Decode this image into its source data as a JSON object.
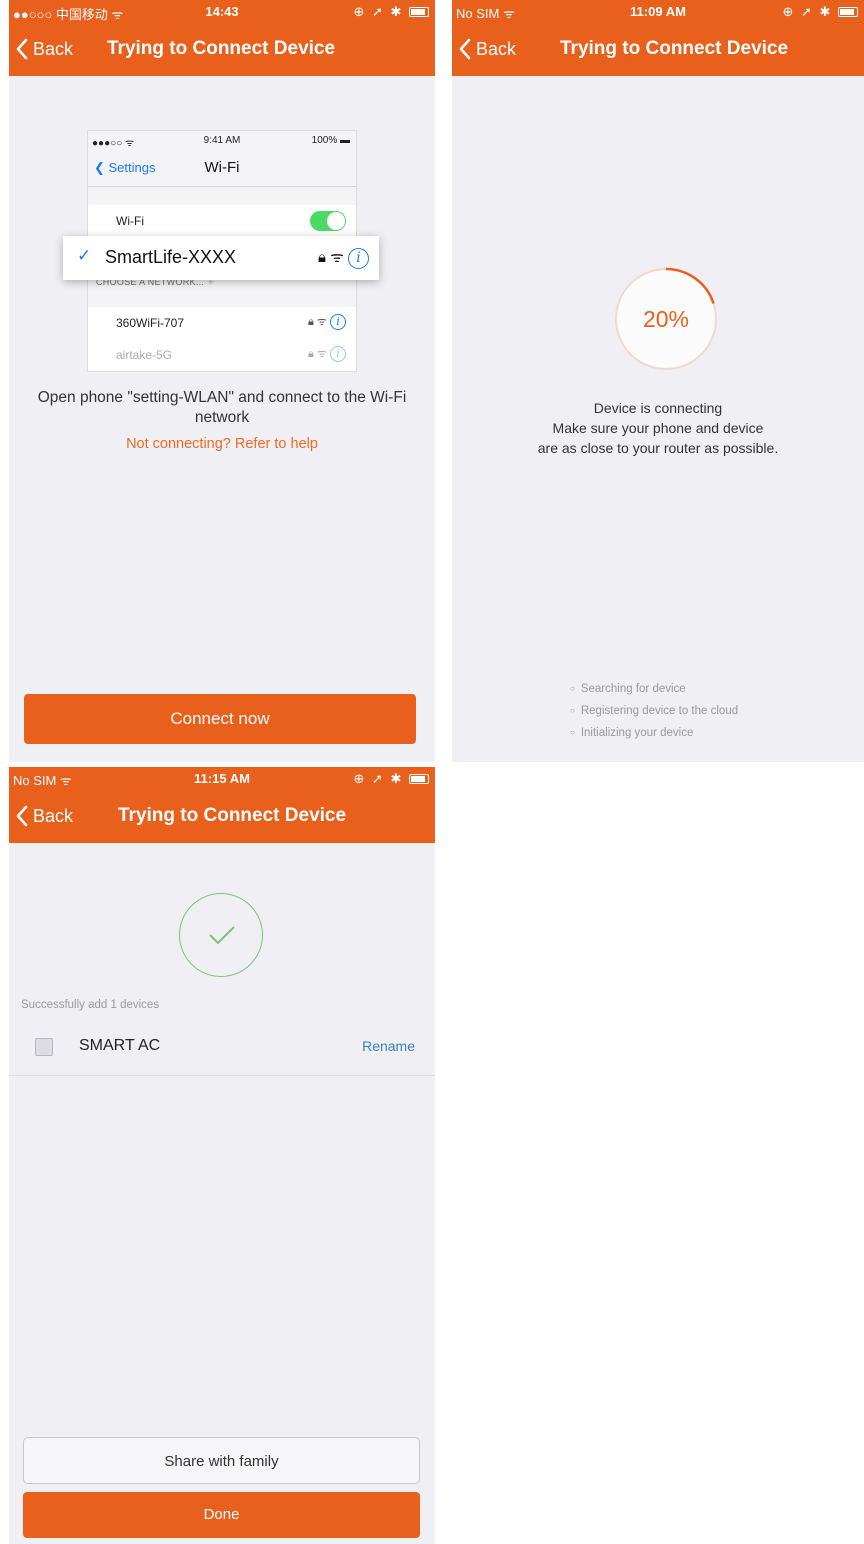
{
  "screen1": {
    "status": {
      "carrier": "●●○○○ 中国移动 ᯤ",
      "time": "14:43",
      "icons": "⊕ ➚ ✱"
    },
    "nav": {
      "back": "Back",
      "title": "Trying to Connect Device"
    },
    "illustration": {
      "status": {
        "left": "●●●○○ ᯤ",
        "time": "9:41 AM",
        "right": "100% ▬"
      },
      "back": "Settings",
      "title": "Wi-Fi",
      "wifi_label": "Wi-Fi",
      "wifi_on": true,
      "selected_network": "SmartLife-XXXX",
      "choose_label": "CHOOSE A NETWORK...",
      "networks": [
        "360WiFi-707",
        "airtake-5G"
      ]
    },
    "instruction": "Open phone \"setting-WLAN\" and connect to the Wi-Fi network",
    "help_link": "Not connecting? Refer to help",
    "connect_button": "Connect now"
  },
  "screen2": {
    "status": {
      "carrier": "No SIM ᯤ",
      "time": "11:09 AM",
      "icons": "⊕ ➚ ✱"
    },
    "nav": {
      "back": "Back",
      "title": "Trying to Connect Device"
    },
    "progress": 0.2,
    "progress_label": "20%",
    "message": [
      "Device is connecting",
      "Make sure your phone and device",
      "are as close to your router as possible."
    ],
    "steps": [
      "Searching for device",
      "Registering device to the cloud",
      "Initializing your device"
    ],
    "accent_color": "#e8601c"
  },
  "screen3": {
    "status": {
      "carrier": "No SIM ᯤ",
      "time": "11:15 AM",
      "icons": "⊕ ➚ ✱"
    },
    "nav": {
      "back": "Back",
      "title": "Trying to Connect Device"
    },
    "success_text": "Successfully add 1 devices",
    "device": {
      "name": "SMART AC",
      "rename": "Rename"
    },
    "share_button": "Share with family",
    "done_button": "Done",
    "success_color": "#7cc37c"
  }
}
